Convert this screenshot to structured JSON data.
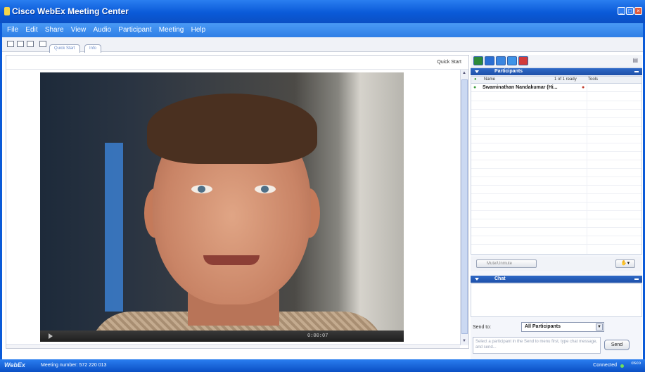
{
  "window": {
    "title": "Cisco WebEx Meeting Center"
  },
  "menu": [
    "File",
    "Edit",
    "Share",
    "View",
    "Audio",
    "Participant",
    "Meeting",
    "Help"
  ],
  "tabs": [
    "Quick Start",
    "Info"
  ],
  "quick_start_label": "Quick Start",
  "video": {
    "time": "0:00:07"
  },
  "participants": {
    "header": "Participants",
    "columns": {
      "name": "Name",
      "count": "1 of 1 ready",
      "tools": "Tools"
    },
    "rows": [
      {
        "name": "Swaminathan Nandakumar (Hi..."
      }
    ]
  },
  "mute_button": "Mute/Unmute",
  "chat": {
    "header": "Chat",
    "send_to_label": "Send to:",
    "send_to_value": "All Participants",
    "input_placeholder": "Select a participant in the Send to menu first, type chat message, and send...",
    "send_label": "Send"
  },
  "status": {
    "logo": "WebEx",
    "meeting_number": "Meeting number: 572 220 013",
    "connection": "Connected",
    "brand": "cisco"
  },
  "colors": {
    "title_blue": "#0a5ad8",
    "panel_header": "#1d4fa8"
  }
}
